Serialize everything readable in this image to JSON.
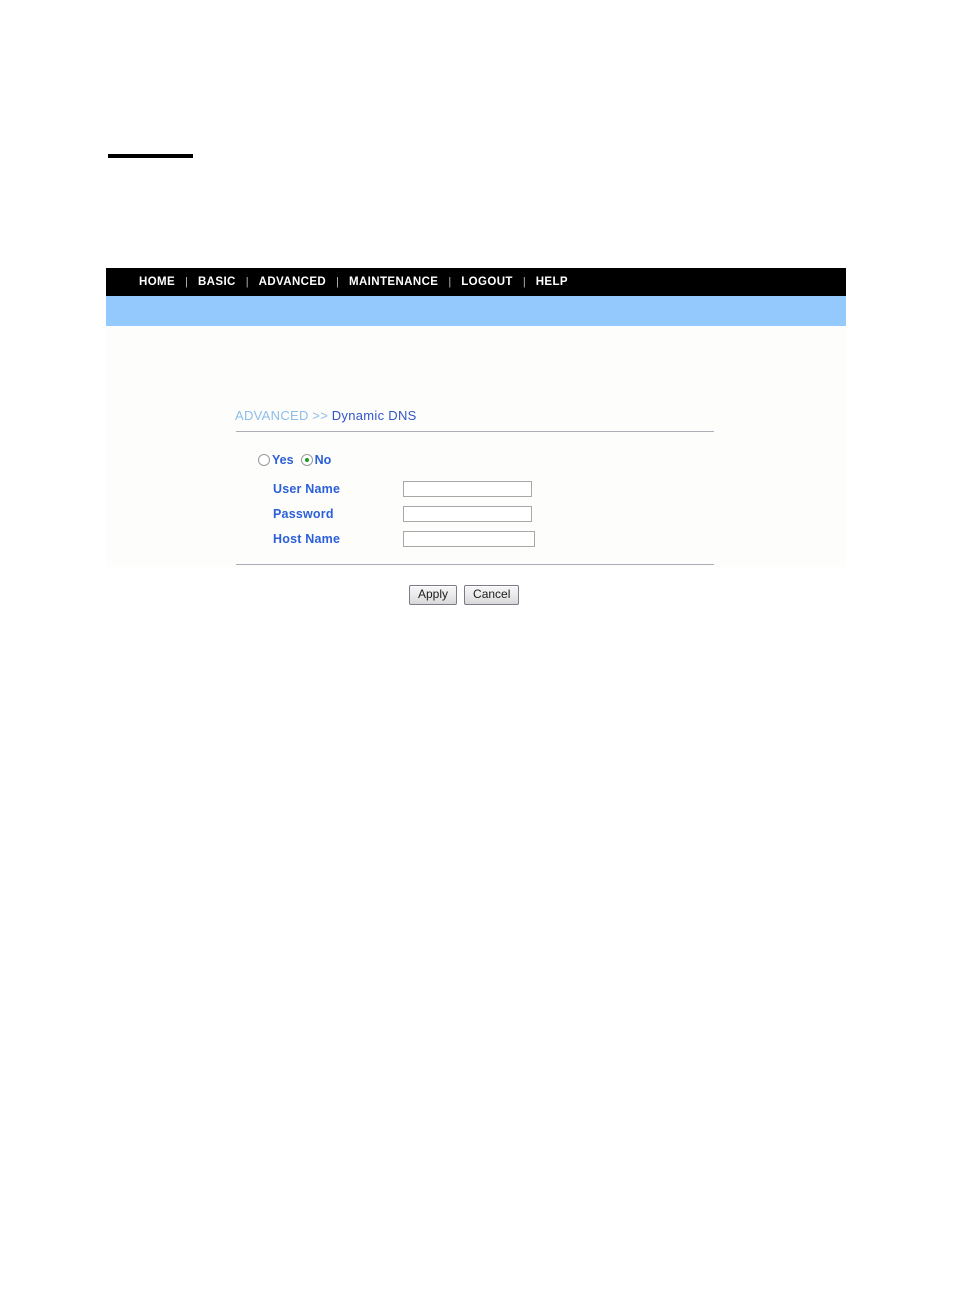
{
  "page": {
    "background": "#ffffff",
    "accent_blue": "#93c9fd",
    "label_blue": "#2b5fd9",
    "crumb_parent_blue": "#8dbdea",
    "crumb_current_blue": "#3355cc"
  },
  "navbar": {
    "separator": "|",
    "items": [
      {
        "label": "HOME"
      },
      {
        "label": "BASIC"
      },
      {
        "label": "ADVANCED"
      },
      {
        "label": "MAINTENANCE"
      },
      {
        "label": "LOGOUT"
      },
      {
        "label": "HELP"
      }
    ]
  },
  "breadcrumb": {
    "parent": "ADVANCED",
    "separator": ">>",
    "current": "Dynamic DNS"
  },
  "enable_group": {
    "options": [
      {
        "label": "Yes",
        "checked": false
      },
      {
        "label": "No",
        "checked": true
      }
    ]
  },
  "form": {
    "fields": [
      {
        "label": "User Name",
        "value": "",
        "placeholder": ""
      },
      {
        "label": "Password",
        "value": "",
        "placeholder": ""
      },
      {
        "label": "Host Name",
        "value": "",
        "placeholder": ""
      }
    ]
  },
  "buttons": {
    "apply": "Apply",
    "cancel": "Cancel"
  }
}
